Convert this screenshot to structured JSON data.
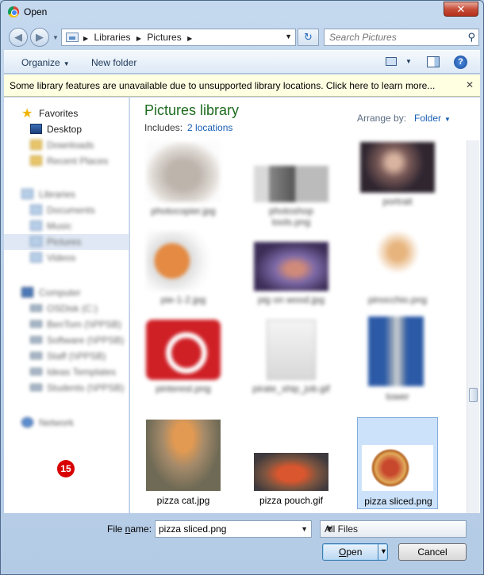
{
  "window": {
    "title": "Open",
    "close_glyph": "✕"
  },
  "address": {
    "back_glyph": "◀",
    "forward_glyph": "▶",
    "crumbs": [
      "▶",
      "Libraries",
      "▶",
      "Pictures",
      "▶"
    ],
    "refresh_glyph": "↻"
  },
  "search": {
    "placeholder": "Search Pictures"
  },
  "toolbar": {
    "organize_label": "Organize",
    "new_folder_label": "New folder",
    "help_glyph": "?"
  },
  "infobar": {
    "message": "Some library features are unavailable due to unsupported library locations. Click here to learn more...",
    "close_glyph": "✕"
  },
  "sidebar": {
    "favorites": {
      "label": "Favorites",
      "items": [
        "Desktop",
        "Downloads",
        "Recent Places"
      ]
    },
    "libraries": {
      "label": "Libraries",
      "items": [
        "Documents",
        "Music",
        "Pictures",
        "Videos"
      ]
    },
    "computer": {
      "label": "Computer",
      "items": [
        "OSDisk (C:)",
        "BenTom (\\\\PPSB)",
        "Software (\\\\PPSB)",
        "Staff (\\\\PPSB)",
        "Ideas Templates",
        "Students (\\\\PPSB)"
      ]
    },
    "network": {
      "label": "Network"
    }
  },
  "annotation_badge": "15",
  "library": {
    "title": "Pictures library",
    "includes_label": "Includes:",
    "locations_link": "2 locations",
    "arrange_label": "Arrange by:",
    "arrange_value": "Folder"
  },
  "files": [
    {
      "name": "photocopier.jpg",
      "blurred": true
    },
    {
      "name": "photoshop tools.png",
      "blurred": true
    },
    {
      "name": "portrait",
      "blurred": true
    },
    {
      "name": "pie-1-2.jpg",
      "blurred": true
    },
    {
      "name": "pig on wood.jpg",
      "blurred": true
    },
    {
      "name": "pinocchio.png",
      "blurred": true
    },
    {
      "name": "pinterest.png",
      "blurred": true
    },
    {
      "name": "pirate_ship_job.gif",
      "blurred": true
    },
    {
      "name": "tower",
      "blurred": true
    },
    {
      "name": "pizza cat.jpg",
      "blurred": false
    },
    {
      "name": "pizza pouch.gif",
      "blurred": false
    },
    {
      "name": "pizza sliced.png",
      "blurred": false
    }
  ],
  "footer": {
    "file_name_label_pre": "File ",
    "file_name_label_u": "n",
    "file_name_label_post": "ame:",
    "file_name_value": "pizza sliced.png",
    "file_type_value": "All Files",
    "open_label": "Open",
    "cancel_label": "Cancel"
  }
}
